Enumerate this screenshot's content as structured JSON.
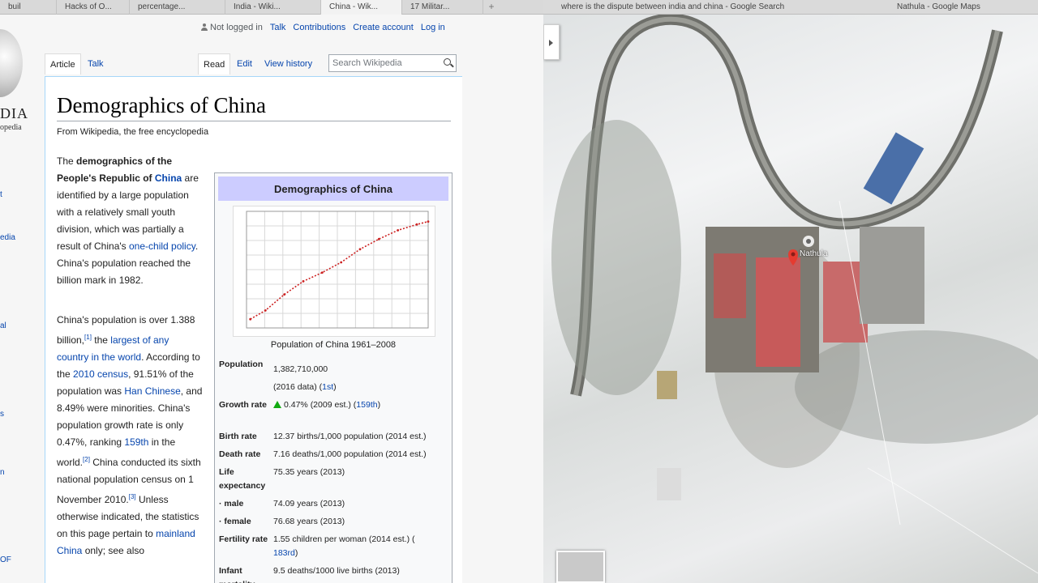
{
  "browser": {
    "left_tabs": [
      "buil",
      "Hacks of O...",
      "percentage...",
      "India - Wiki...",
      "China - Wik...",
      "17 Militar..."
    ],
    "new_tab": "+",
    "right_tabs": [
      "where is the dispute between india and china - Google Search",
      "Nathula - Google Maps"
    ]
  },
  "wiki": {
    "logo_word": "DIA",
    "logo_sub": "opedia",
    "side_links": [
      "t",
      "edia",
      "al",
      "s",
      "n",
      "OF"
    ],
    "personal": {
      "not_logged_in": "Not logged in",
      "talk": "Talk",
      "contributions": "Contributions",
      "create_account": "Create account",
      "login": "Log in"
    },
    "tabs": {
      "article": "Article",
      "talk": "Talk",
      "read": "Read",
      "edit": "Edit",
      "history": "View history"
    },
    "search_placeholder": "Search Wikipedia",
    "title": "Demographics of China",
    "from": "From Wikipedia, the free encyclopedia",
    "para1": {
      "t1": "The ",
      "b1": "demographics of the People's Republic of ",
      "l1": "China",
      "t2": " are identified by a large population with a relatively small youth division, which was partially a result of China's ",
      "l2": "one-child policy",
      "t3": ". China's population reached the billion mark in 1982."
    },
    "para2": {
      "t1": "China's population is over 1.388 billion,",
      "s1": "[1]",
      "t2": " the ",
      "l1": "largest of any country in the world",
      "t3": ". According to the ",
      "l2": "2010 census",
      "t4": ", 91.51% of the population was ",
      "l3": "Han Chinese",
      "t5": ", and 8.49% were minorities. China's population growth rate is only 0.47%, ranking ",
      "l4": "159th",
      "t6": " in the world.",
      "s2": "[2]",
      "t7": " China conducted its sixth national population census on 1 November 2010.",
      "s3": "[3]",
      "t8": " Unless otherwise indicated, the statistics on this page pertain to ",
      "l5": "mainland China",
      "t9": " only; see also"
    },
    "infobox": {
      "title": "Demographics of China",
      "caption": "Population of China 1961–2008",
      "rows": [
        {
          "label": "Population",
          "value": "1,382,710,000",
          "sub": "(2016 data) (",
          "link": "1st",
          "tail": ")"
        },
        {
          "label": "Growth rate",
          "value": "0.47% (2009 est.) (",
          "link": "159th",
          "tail": ")"
        },
        {
          "label": "Birth rate",
          "value": "12.37 births/1,000 population (2014 est.)"
        },
        {
          "label": "Death rate",
          "value": "7.16 deaths/1,000 population (2014 est.)"
        },
        {
          "label": "Life expectancy",
          "value": "75.35 years (2013)"
        },
        {
          "label": " · male",
          "value": "74.09 years (2013)"
        },
        {
          "label": " · female",
          "value": "76.68 years (2013)"
        },
        {
          "label": "Fertility rate",
          "value": "1.55 children per woman (2014 est.) (",
          "link": "183rd",
          "tail": ")"
        },
        {
          "label": "Infant mortality rate",
          "value": "9.5 deaths/1000 live births (2013)"
        }
      ]
    }
  },
  "chart_data": {
    "type": "line",
    "x": [
      1961,
      1965,
      1970,
      1975,
      1980,
      1985,
      1990,
      1995,
      2000,
      2005,
      2008
    ],
    "series": [
      {
        "values": [
          0.66,
          0.72,
          0.83,
          0.92,
          0.98,
          1.05,
          1.14,
          1.21,
          1.27,
          1.31,
          1.33
        ]
      }
    ],
    "xlim": [
      1960,
      2008
    ],
    "ylim": [
      0.6,
      1.4
    ],
    "grid": true,
    "color": "#cc2222"
  },
  "map": {
    "place_label": "Nathula"
  }
}
